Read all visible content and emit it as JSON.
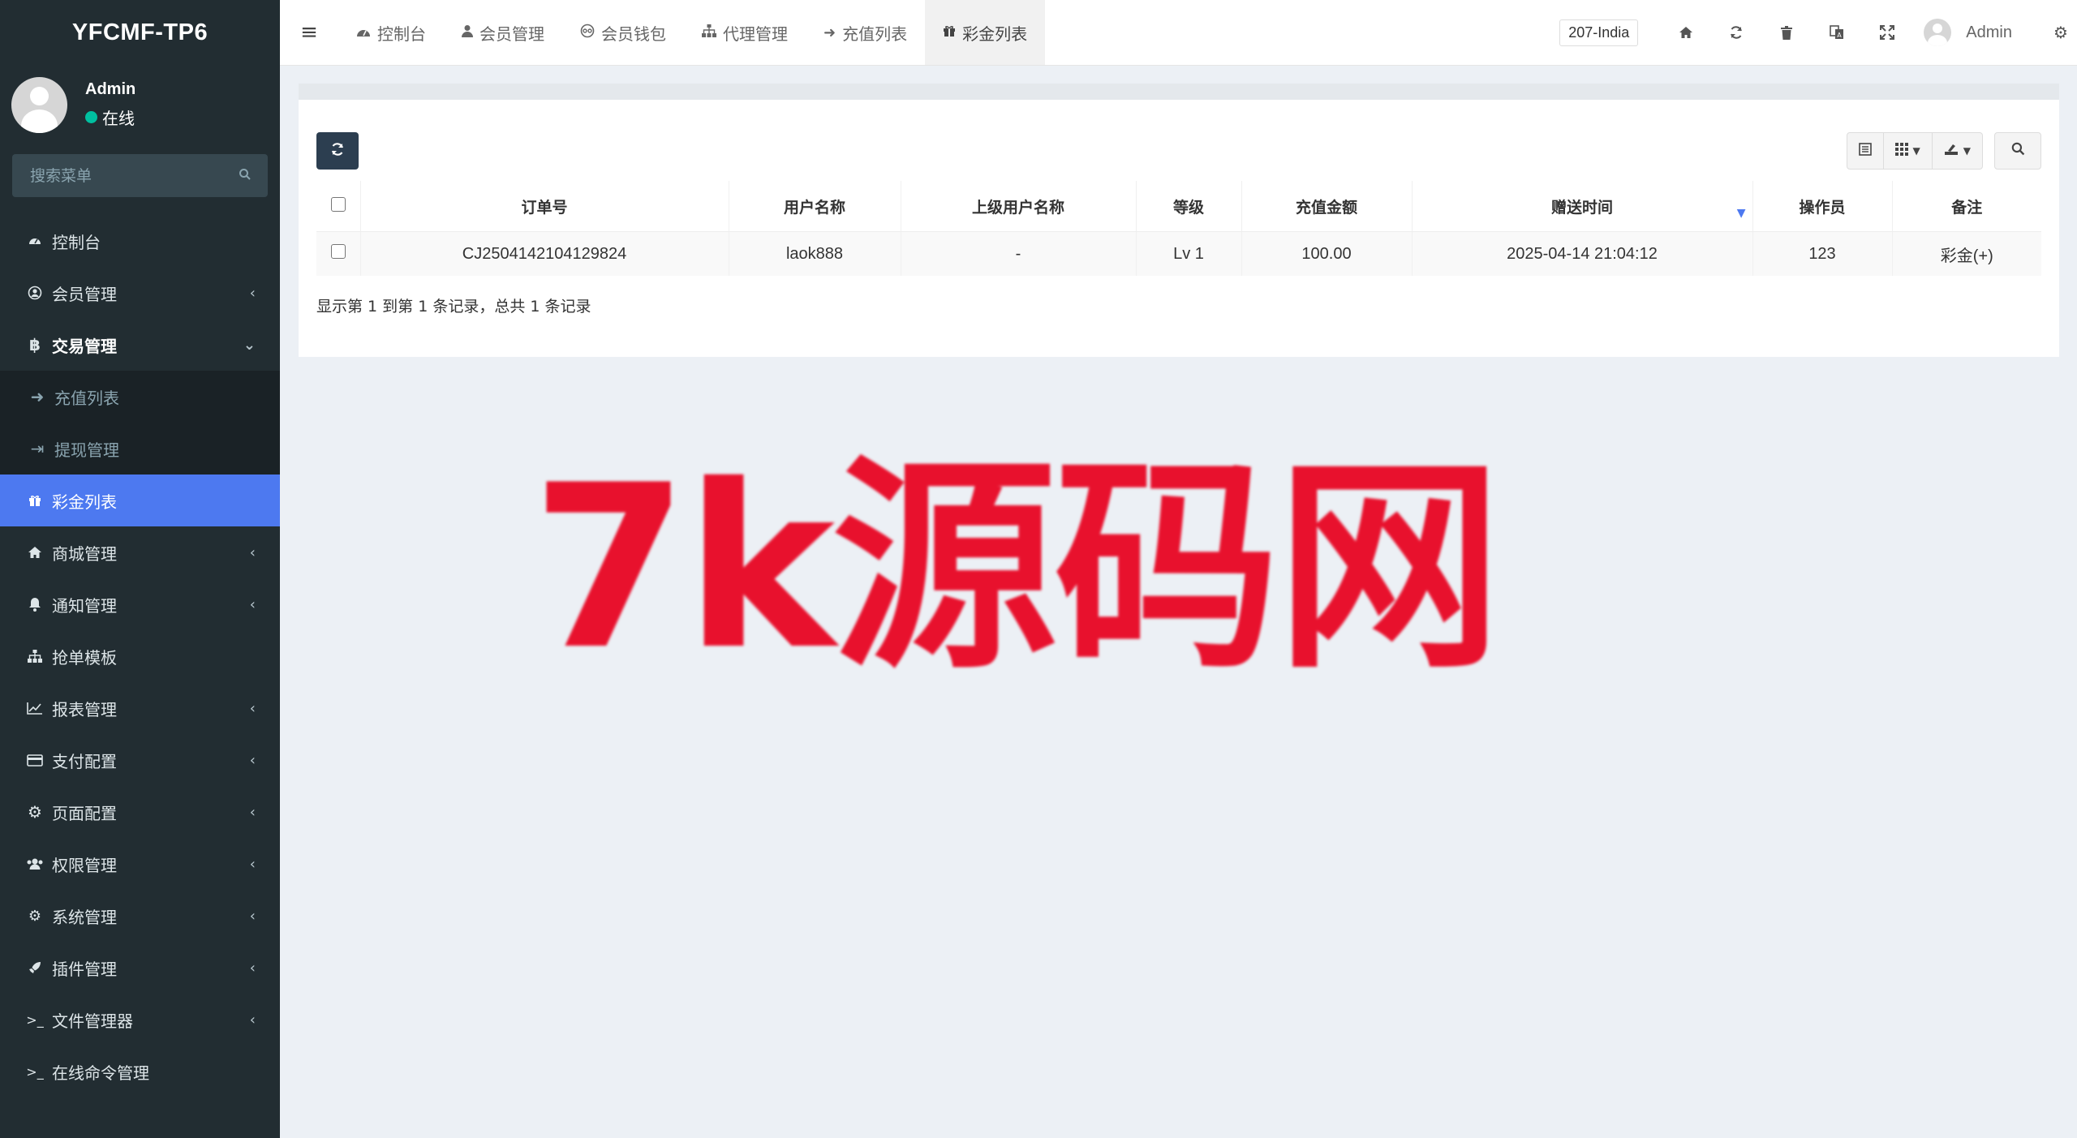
{
  "app": {
    "logo_text": "YFCMF-TP6"
  },
  "user_panel": {
    "name": "Admin",
    "status": "在线",
    "status_color": "#00c0a0"
  },
  "sidebar": {
    "search_placeholder": "搜索菜单",
    "items": [
      {
        "label": "控制台",
        "icon": "dashboard-icon",
        "has_children": false
      },
      {
        "label": "会员管理",
        "icon": "user-circle-icon",
        "has_children": true
      },
      {
        "label": "交易管理",
        "icon": "bitcoin-icon",
        "has_children": true,
        "expanded": true,
        "children": [
          {
            "label": "充值列表",
            "icon": "sign-in-icon"
          },
          {
            "label": "提现管理",
            "icon": "sign-out-icon"
          },
          {
            "label": "彩金列表",
            "icon": "gift-icon",
            "active": true
          }
        ]
      },
      {
        "label": "商城管理",
        "icon": "home-icon",
        "has_children": true
      },
      {
        "label": "通知管理",
        "icon": "bell-icon",
        "has_children": true
      },
      {
        "label": "抢单模板",
        "icon": "sitemap-icon",
        "has_children": false
      },
      {
        "label": "报表管理",
        "icon": "line-chart-icon",
        "has_children": true
      },
      {
        "label": "支付配置",
        "icon": "credit-card-icon",
        "has_children": true
      },
      {
        "label": "页面配置",
        "icon": "gear-icon",
        "has_children": true
      },
      {
        "label": "权限管理",
        "icon": "users-icon",
        "has_children": true
      },
      {
        "label": "系统管理",
        "icon": "gears-icon",
        "has_children": true
      },
      {
        "label": "插件管理",
        "icon": "rocket-icon",
        "has_children": true
      },
      {
        "label": "文件管理器",
        "icon": "terminal-icon",
        "has_children": true
      },
      {
        "label": "在线命令管理",
        "icon": "terminal-icon",
        "has_children": false
      }
    ],
    "active_color": "#4d79f0"
  },
  "topbar": {
    "tabs": [
      {
        "label": "控制台",
        "icon": "dashboard-icon"
      },
      {
        "label": "会员管理",
        "icon": "user-icon"
      },
      {
        "label": "会员钱包",
        "icon": "wallet-icon"
      },
      {
        "label": "代理管理",
        "icon": "sitemap-icon"
      },
      {
        "label": "充值列表",
        "icon": "sign-in-icon"
      },
      {
        "label": "彩金列表",
        "icon": "gift-icon",
        "active": true
      }
    ],
    "lang_badge": "207-India",
    "admin_name": "Admin"
  },
  "table": {
    "columns": [
      "订单号",
      "用户名称",
      "上级用户名称",
      "等级",
      "充值金额",
      "赠送时间",
      "操作员",
      "备注"
    ],
    "sorted_column": "赠送时间",
    "rows": [
      {
        "order_no": "CJ2504142104129824",
        "username": "laok888",
        "parent_username": "-",
        "level": "Lv 1",
        "amount": "100.00",
        "gift_time": "2025-04-14 21:04:12",
        "operator": "123",
        "remark": "彩金(+)"
      }
    ],
    "pagination_info": "显示第 1 到第 1 条记录，总共 1 条记录"
  },
  "watermark": {
    "text": "7k源码网",
    "color": "#e8112d"
  }
}
